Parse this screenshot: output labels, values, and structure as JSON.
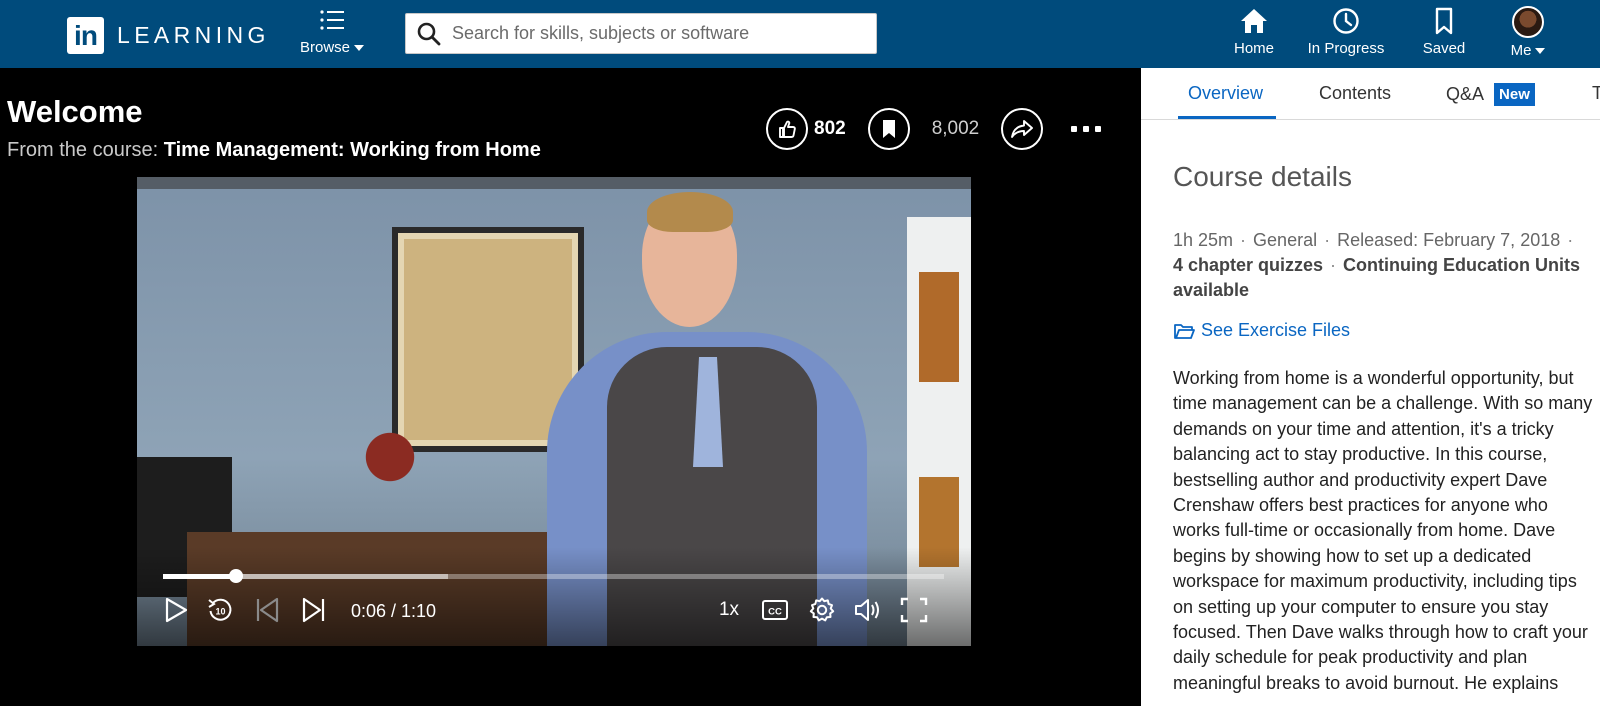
{
  "topnav": {
    "logo_in": "in",
    "logo_text": "LEARNING",
    "browse_label": "Browse",
    "search_placeholder": "Search for skills, subjects or software",
    "items": [
      {
        "label": "Home",
        "icon": "home-icon"
      },
      {
        "label": "In Progress",
        "icon": "clock-icon"
      },
      {
        "label": "Saved",
        "icon": "bookmark-icon"
      },
      {
        "label": "Me",
        "icon": "avatar"
      }
    ]
  },
  "video": {
    "title": "Welcome",
    "course_prefix": "From the course:",
    "course_name": "Time Management: Working from Home",
    "likes": "802",
    "saves": "8,002",
    "time": "0:06 / 1:10",
    "speed": "1x",
    "progress_fraction": 0.093,
    "buffer_fraction": 0.365
  },
  "panel": {
    "tabs": [
      {
        "label": "Overview",
        "active": true
      },
      {
        "label": "Contents",
        "active": false
      },
      {
        "label": "Q&A",
        "active": false,
        "badge": "New"
      },
      {
        "label": "T",
        "active": false
      }
    ],
    "section_title": "Course details",
    "meta": {
      "duration": "1h 25m",
      "level": "General",
      "released": "Released: February 7, 2018",
      "quizzes": "4 chapter quizzes",
      "ceu": "Continuing Education Units",
      "ceu_suffix": "available"
    },
    "exercise_label": "See Exercise Files",
    "description": "Working from home is a wonderful opportunity, but time management can be a challenge. With so many demands on your time and attention, it's a tricky balancing act to stay productive. In this course, bestselling author and productivity expert Dave Crenshaw offers best practices for anyone who works full-time or occasionally from home. Dave begins by showing how to set up a dedicated workspace for maximum productivity, including tips on setting up your computer to ensure you stay focused. Then Dave walks through how to craft your daily schedule for peak productivity and plan meaningful breaks to avoid burnout. He explains"
  }
}
